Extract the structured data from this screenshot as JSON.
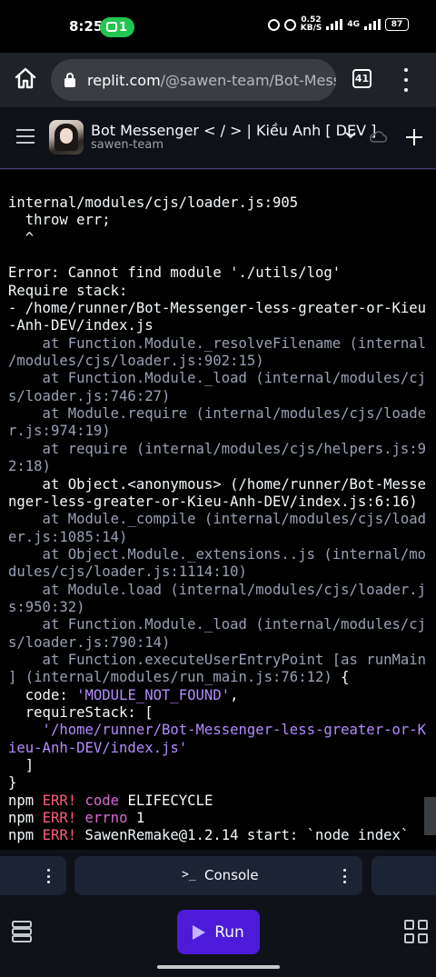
{
  "status_bar": {
    "time": "8:25",
    "notification_count": "1",
    "speed_value": "0.52",
    "speed_unit": "KB/S",
    "network": "4G",
    "battery": "87"
  },
  "browser": {
    "url_host": "replit.com",
    "url_path": "/@sawen-team/Bot-Messenger",
    "tab_count": "41"
  },
  "repl": {
    "title": "Bot Messenger < / > | Kiều Anh [ DEV ]",
    "owner": "sawen-team"
  },
  "console": {
    "lines": [
      {
        "t": "internal/modules/cjs/loader.js:905",
        "c": "w"
      },
      {
        "t": "  throw err;",
        "c": "w"
      },
      {
        "t": "  ^",
        "c": "w"
      },
      {
        "t": "",
        "c": "w"
      },
      {
        "t": "Error: Cannot find module './utils/log'",
        "c": "w"
      },
      {
        "t": "Require stack:",
        "c": "w"
      },
      {
        "t": "- /home/runner/Bot-Messenger-less-greater-or-Kieu",
        "c": "w"
      },
      {
        "t": "-Anh-DEV/index.js",
        "c": "w"
      },
      {
        "t": "    at Function.Module._resolveFilename (internal",
        "c": "g"
      },
      {
        "t": "/modules/cjs/loader.js:902:15)",
        "c": "g"
      },
      {
        "t": "    at Function.Module._load (internal/modules/cj",
        "c": "g"
      },
      {
        "t": "s/loader.js:746:27)",
        "c": "g"
      },
      {
        "t": "    at Module.require (internal/modules/cjs/loade",
        "c": "g"
      },
      {
        "t": "r.js:974:19)",
        "c": "g"
      },
      {
        "t": "    at require (internal/modules/cjs/helpers.js:9",
        "c": "g"
      },
      {
        "t": "2:18)",
        "c": "g"
      },
      {
        "t": "    at Object.<anonymous> (/home/runner/Bot-Messe",
        "c": "w"
      },
      {
        "t": "nger-less-greater-or-Kieu-Anh-DEV/index.js:6:16)",
        "c": "w"
      },
      {
        "t": "    at Module._compile (internal/modules/cjs/load",
        "c": "g"
      },
      {
        "t": "er.js:1085:14)",
        "c": "g"
      },
      {
        "t": "    at Object.Module._extensions..js (internal/mo",
        "c": "g"
      },
      {
        "t": "dules/cjs/loader.js:1114:10)",
        "c": "g"
      },
      {
        "t": "    at Module.load (internal/modules/cjs/loader.j",
        "c": "g"
      },
      {
        "t": "s:950:32)",
        "c": "g"
      },
      {
        "t": "    at Function.Module._load (internal/modules/cj",
        "c": "g"
      },
      {
        "t": "s/loader.js:790:14)",
        "c": "g"
      },
      {
        "t": "    at Function.executeUserEntryPoint [as runMain",
        "c": "g"
      },
      {
        "t": "] (internal/modules/run_main.js:76:12) {",
        "mixed": [
          [
            "] (internal/modules/run_main.js:76:12)",
            "g"
          ],
          [
            " {",
            "w"
          ]
        ]
      },
      {
        "t": "  code: 'MODULE_NOT_FOUND',",
        "mixed": [
          [
            "  code: ",
            "w"
          ],
          [
            "'MODULE_NOT_FOUND'",
            "s"
          ],
          [
            ",",
            "w"
          ]
        ]
      },
      {
        "t": "  requireStack: [",
        "c": "w"
      },
      {
        "t": "    '/home/runner/Bot-Messenger-less-greater-or-K",
        "c": "s"
      },
      {
        "t": "ieu-Anh-DEV/index.js'",
        "c": "s"
      },
      {
        "t": "  ]",
        "c": "w"
      },
      {
        "t": "}",
        "c": "w"
      },
      {
        "t": "npm ERR! code ELIFECYCLE",
        "mixed": [
          [
            "npm ",
            "w"
          ],
          [
            "ERR!",
            "r"
          ],
          [
            " ",
            "w"
          ],
          [
            "code",
            "m"
          ],
          [
            " ELIFECYCLE",
            "w"
          ]
        ]
      },
      {
        "t": "npm ERR! errno 1",
        "mixed": [
          [
            "npm ",
            "w"
          ],
          [
            "ERR!",
            "r"
          ],
          [
            " ",
            "w"
          ],
          [
            "errno",
            "m"
          ],
          [
            " 1",
            "w"
          ]
        ]
      },
      {
        "t": "npm ERR! SawenRemake@1.2.14 start: `node index`",
        "mixed": [
          [
            "npm ",
            "w"
          ],
          [
            "ERR!",
            "r"
          ],
          [
            " SawenRemake@1.2.14 start: `node index`",
            "w"
          ]
        ]
      }
    ]
  },
  "tabs": {
    "console_label": "Console",
    "console_prompt": ">_"
  },
  "toolbar": {
    "run_label": "Run"
  }
}
